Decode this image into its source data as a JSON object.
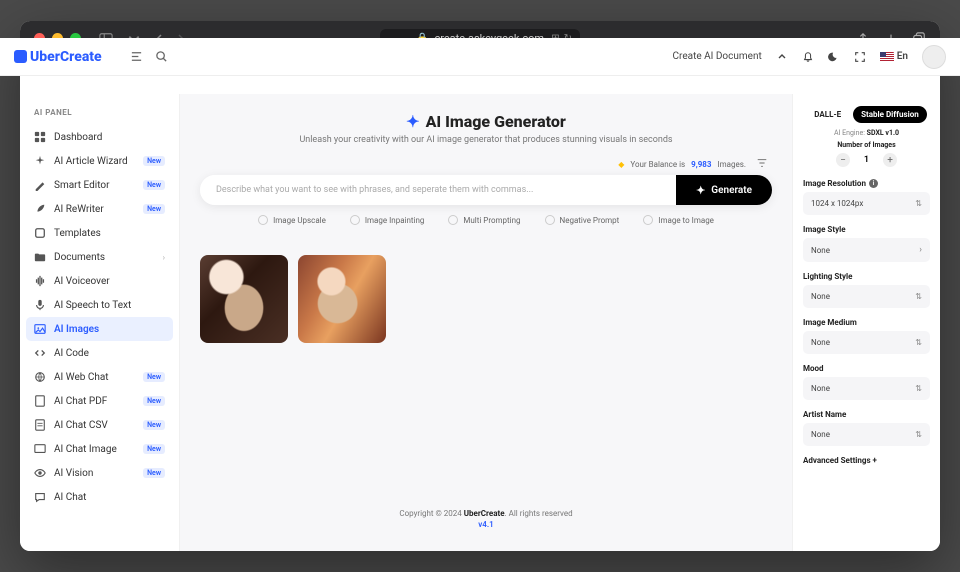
{
  "browser": {
    "url": "create.askeygeek.com"
  },
  "brand": "UberCreate",
  "topbar": {
    "create_doc": "Create AI Document",
    "lang": "En"
  },
  "sidebar": {
    "title": "AI PANEL",
    "items": [
      {
        "label": "Dashboard",
        "icon": "grid"
      },
      {
        "label": "AI Article Wizard",
        "icon": "sparkle",
        "badge": "New"
      },
      {
        "label": "Smart Editor",
        "icon": "pen",
        "badge": "New"
      },
      {
        "label": "AI ReWriter",
        "icon": "feather",
        "badge": "New"
      },
      {
        "label": "Templates",
        "icon": "squares"
      },
      {
        "label": "Documents",
        "icon": "folder",
        "chevron": true
      },
      {
        "label": "AI Voiceover",
        "icon": "voice"
      },
      {
        "label": "AI Speech to Text",
        "icon": "mic"
      },
      {
        "label": "AI Images",
        "icon": "image",
        "active": true
      },
      {
        "label": "AI Code",
        "icon": "code"
      },
      {
        "label": "AI Web Chat",
        "icon": "globe",
        "badge": "New"
      },
      {
        "label": "AI Chat PDF",
        "icon": "pdf",
        "badge": "New"
      },
      {
        "label": "AI Chat CSV",
        "icon": "csv",
        "badge": "New"
      },
      {
        "label": "AI Chat Image",
        "icon": "imgchat",
        "badge": "New"
      },
      {
        "label": "AI Vision",
        "icon": "eye",
        "badge": "New"
      },
      {
        "label": "AI Chat",
        "icon": "chat"
      }
    ]
  },
  "main": {
    "title": "AI Image Generator",
    "subtitle": "Unleash your creativity with our AI image generator that produces stunning visuals in seconds",
    "balance_prefix": "Your Balance is",
    "balance_value": "9,983",
    "balance_suffix": "Images.",
    "prompt_placeholder": "Describe what you want to see with phrases, and seperate them with commas...",
    "generate": "Generate",
    "options": [
      "Image Upscale",
      "Image Inpainting",
      "Multi Prompting",
      "Negative Prompt",
      "Image to Image"
    ]
  },
  "footer": {
    "prefix": "Copyright © 2024 ",
    "brand": "UberCreate",
    "suffix": ". All rights reserved",
    "version": "v4.1"
  },
  "right": {
    "tabs": {
      "dalle": "DALL-E",
      "sd": "Stable Diffusion"
    },
    "engine_label": "AI Engine:",
    "engine_value": "SDXL v1.0",
    "num_images_label": "Number of Images",
    "num_images_value": "1",
    "fields": {
      "resolution": {
        "label": "Image Resolution",
        "value": "1024 x 1024px",
        "info": true,
        "arrows": true
      },
      "style": {
        "label": "Image Style",
        "value": "None",
        "chevron": true
      },
      "lighting": {
        "label": "Lighting Style",
        "value": "None",
        "arrows": true
      },
      "medium": {
        "label": "Image Medium",
        "value": "None",
        "arrows": true
      },
      "mood": {
        "label": "Mood",
        "value": "None",
        "arrows": true
      },
      "artist": {
        "label": "Artist Name",
        "value": "None",
        "arrows": true
      }
    },
    "advanced": "Advanced Settings +"
  }
}
